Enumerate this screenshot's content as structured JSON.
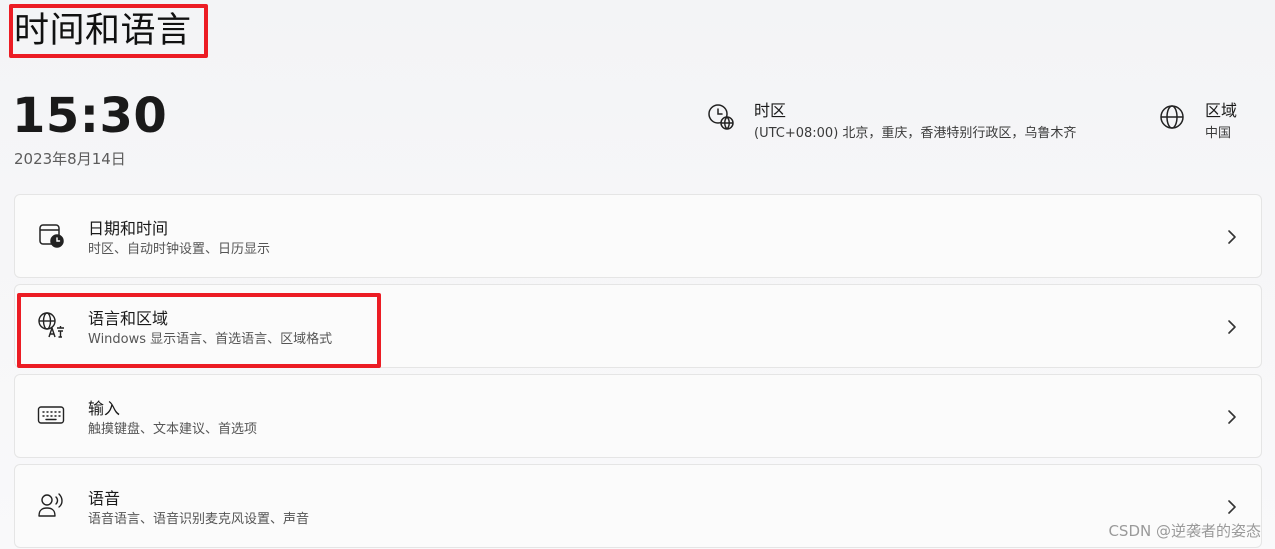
{
  "page": {
    "title": "时间和语言"
  },
  "clock": {
    "time": "15:30",
    "date": "2023年8月14日"
  },
  "header_info": {
    "timezone": {
      "label": "时区",
      "value": "(UTC+08:00) 北京，重庆，香港特别行政区，乌鲁木齐",
      "icon": "globe-clock-icon"
    },
    "region": {
      "label": "区域",
      "value": "中国",
      "icon": "globe-icon"
    }
  },
  "cards": [
    {
      "title": "日期和时间",
      "description": "时区、自动时钟设置、日历显示",
      "icon": "calendar-clock-icon"
    },
    {
      "title": "语言和区域",
      "description": "Windows 显示语言、首选语言、区域格式",
      "icon": "language-icon"
    },
    {
      "title": "输入",
      "description": "触摸键盘、文本建议、首选项",
      "icon": "keyboard-icon"
    },
    {
      "title": "语音",
      "description": "语音语言、语音识别麦克风设置、声音",
      "icon": "speech-icon"
    }
  ],
  "annotations": {
    "highlight_color": "#ec1c24"
  },
  "watermark": "CSDN @逆袭者的姿态"
}
